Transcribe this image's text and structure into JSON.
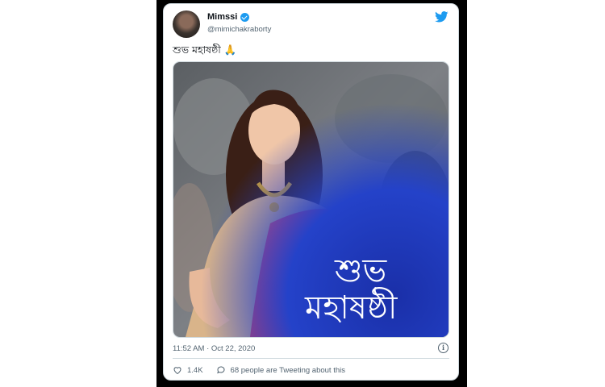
{
  "tweet": {
    "display_name": "Mimssi",
    "handle": "@mimichakraborty",
    "text": "শুভ মহাষষ্ঠী 🙏",
    "media_caption_line1": "শুভ",
    "media_caption_line2": "মহাষষ্ঠী",
    "timestamp": "11:52 AM · Oct 22, 2020",
    "likes": "1.4K",
    "tweeting_about": "68 people are Tweeting about this"
  },
  "colors": {
    "accent": "#1d9bf0",
    "text_secondary": "#536471",
    "border": "#cfd9de"
  },
  "icons": {
    "bird": "twitter-bird-icon",
    "verified": "verified-badge-icon",
    "heart": "heart-icon",
    "reply": "reply-bubble-icon",
    "info": "info-icon"
  }
}
